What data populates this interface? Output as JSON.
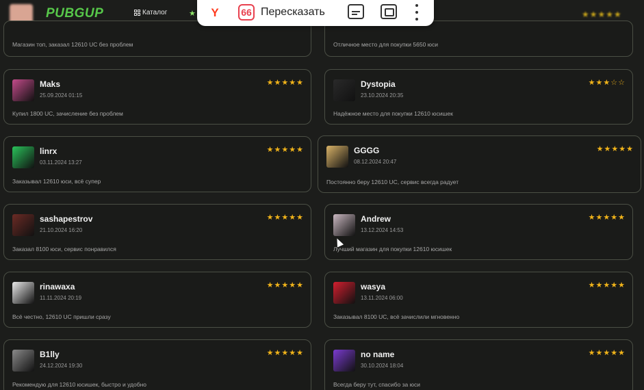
{
  "nav": {
    "logo": "PUBGUP",
    "catalog_label": "Каталог"
  },
  "overlay": {
    "retell_label": "Пересказать"
  },
  "top_snippets": {
    "left_text": "Магазин топ, заказал 12610 UC без проблем",
    "right_text": "Отличное место для покупки 5650 юси"
  },
  "reviews": [
    {
      "name": "Maks",
      "date": "25.09.2024 01:15",
      "text": "Купил 1800 UC, зачисление без проблем",
      "rating": 5,
      "avatar_color": "#c24b8a"
    },
    {
      "name": "Dystopia",
      "date": "23.10.2024 20:35",
      "text": "Надёжное место для покупки 12610 юсишек",
      "rating": 3,
      "avatar_color": "#2a2a2a"
    },
    {
      "name": "linrx",
      "date": "03.11.2024 13:27",
      "text": "Заказывал 12610 юси, всё супер",
      "rating": 5,
      "avatar_color": "#2ac25a"
    },
    {
      "name": "GGGG",
      "date": "08.12.2024 20:47",
      "text": "Постоянно беру 12610 UC, сервис всегда радует",
      "rating": 5,
      "avatar_color": "#d8b267"
    },
    {
      "name": "sashapestrov",
      "date": "21.10.2024 16:20",
      "text": "Заказал 8100 юси, сервис понравился",
      "rating": 5,
      "avatar_color": "#6b2b25"
    },
    {
      "name": "Andrew",
      "date": "13.12.2024 14:53",
      "text": "Лучший магазин для покупки 12610 юсишек",
      "rating": 5,
      "avatar_color": "#c9b7c0"
    },
    {
      "name": "rinawaxa",
      "date": "11.11.2024 20:19",
      "text": "Всё честно, 12610 UC пришли сразу",
      "rating": 5,
      "avatar_color": "#e9e9e9"
    },
    {
      "name": "wasya",
      "date": "13.11.2024 06:00",
      "text": "Заказывал 8100 UC, всё зачислили мгновенно",
      "rating": 5,
      "avatar_color": "#d21f2f"
    },
    {
      "name": "B1lly",
      "date": "24.12.2024 19:30",
      "text": "Рекомендую для 12610 юсишек, быстро и удобно",
      "rating": 5,
      "avatar_color": "#8a8a8a"
    },
    {
      "name": "no name",
      "date": "30.10.2024 18:04",
      "text": "Всегда беру тут, спасибо за юси",
      "rating": 5,
      "avatar_color": "#7a3bd0"
    }
  ]
}
